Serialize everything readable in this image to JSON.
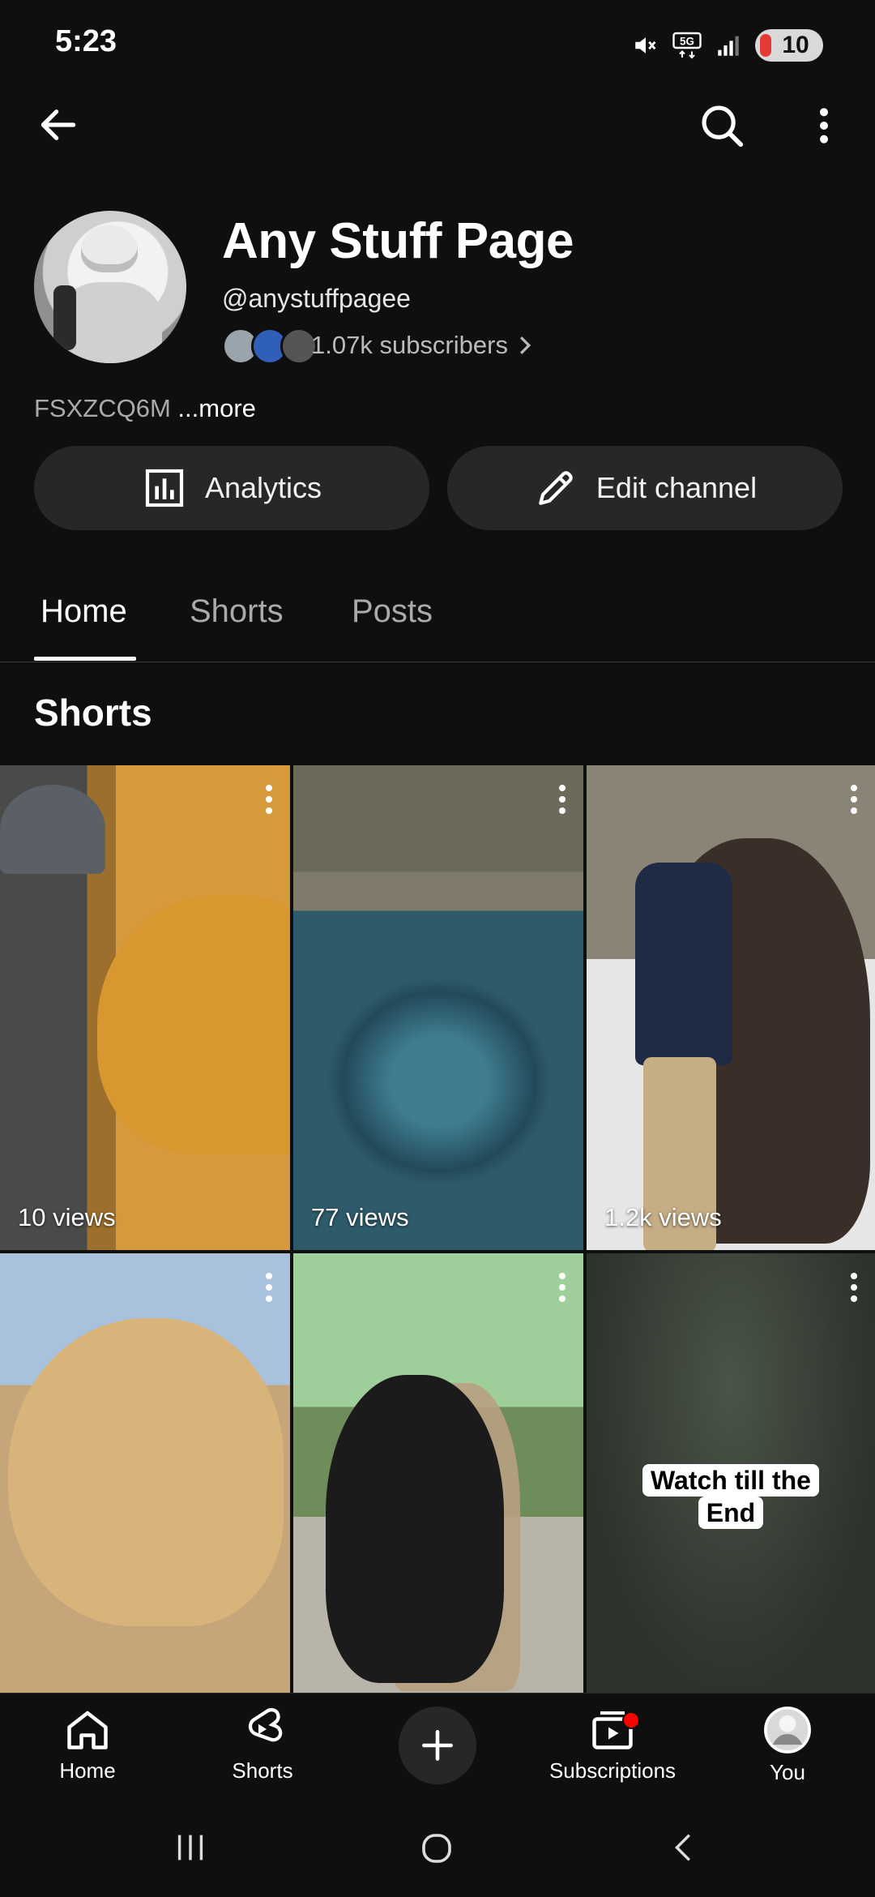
{
  "status_bar": {
    "time": "5:23",
    "battery": "10",
    "network": "5G"
  },
  "icons": {
    "back": "arrow-left-icon",
    "search": "search-icon",
    "more": "more-vertical-icon",
    "analytics": "bar-chart-icon",
    "edit": "pencil-icon",
    "chevron": "chevron-right-icon"
  },
  "channel": {
    "name": "Any Stuff Page",
    "handle": "@anystuffpagee",
    "subscribers": "1.07k subscribers",
    "description": "FSXZCQ6M",
    "more_label": "...more"
  },
  "buttons": {
    "analytics": "Analytics",
    "edit_channel": "Edit channel"
  },
  "tabs": [
    {
      "label": "Home",
      "active": true
    },
    {
      "label": "Shorts",
      "active": false
    },
    {
      "label": "Posts",
      "active": false
    }
  ],
  "shorts_section": {
    "title": "Shorts",
    "items": [
      {
        "views": "10 views"
      },
      {
        "views": "77 views"
      },
      {
        "views": "1.2k views"
      },
      {
        "views": ""
      },
      {
        "views": ""
      },
      {
        "views": "",
        "caption_line1": "Watch till the",
        "caption_line2": "End"
      }
    ]
  },
  "bottom_nav": {
    "home": "Home",
    "shorts": "Shorts",
    "subscriptions": "Subscriptions",
    "you": "You"
  },
  "colors": {
    "background": "#0f0f0f",
    "chip": "#272727",
    "accent_red": "#ff0000"
  }
}
